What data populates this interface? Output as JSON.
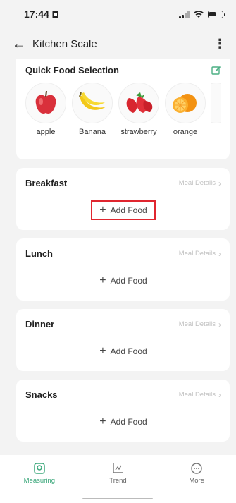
{
  "status": {
    "time": "17:44"
  },
  "nav": {
    "title": "Kitchen Scale"
  },
  "quick": {
    "title": "Quick Food Selection",
    "foods": [
      {
        "label": "apple",
        "icon": "apple-icon"
      },
      {
        "label": "Banana",
        "icon": "banana-icon"
      },
      {
        "label": "strawberry",
        "icon": "strawberry-icon"
      },
      {
        "label": "orange",
        "icon": "orange-icon"
      }
    ]
  },
  "meals": [
    {
      "title": "Breakfast",
      "details": "Meal Details",
      "add": "Add Food"
    },
    {
      "title": "Lunch",
      "details": "Meal Details",
      "add": "Add Food"
    },
    {
      "title": "Dinner",
      "details": "Meal Details",
      "add": "Add Food"
    },
    {
      "title": "Snacks",
      "details": "Meal Details",
      "add": "Add Food"
    }
  ],
  "tabs": [
    {
      "label": "Measuring",
      "icon": "scale-icon"
    },
    {
      "label": "Trend",
      "icon": "trend-icon"
    },
    {
      "label": "More",
      "icon": "more-circle-icon"
    }
  ],
  "colors": {
    "accent": "#3aa77a",
    "highlight": "#e0262f"
  }
}
